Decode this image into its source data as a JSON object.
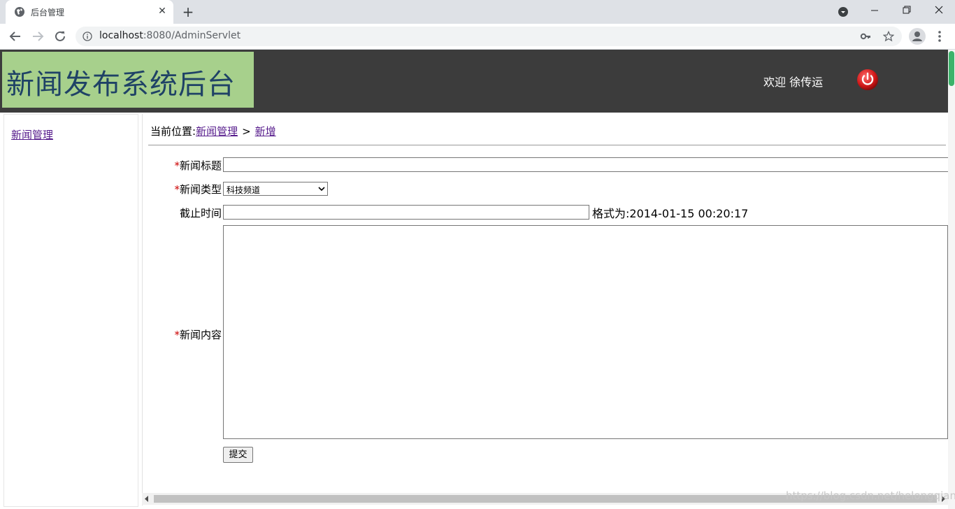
{
  "browser": {
    "tab_title": "后台管理",
    "url_host": "localhost",
    "url_path": ":8080/AdminServlet"
  },
  "header": {
    "logo_text": "新闻发布系统后台",
    "welcome_text": "欢迎 徐传运",
    "power_icon": "power-icon"
  },
  "sidebar": {
    "items": [
      {
        "label": "新闻管理"
      }
    ]
  },
  "breadcrumb": {
    "prefix": "当前位置:",
    "section": "新闻管理",
    "separator": ">",
    "current": "新增"
  },
  "form": {
    "required_mark": "*",
    "title_label": "新闻标题",
    "title_value": "",
    "type_label": "新闻类型",
    "type_selected": "科技频道",
    "deadline_label": "截止时间",
    "deadline_value": "",
    "deadline_hint": "格式为:2014-01-15 00:20:17",
    "content_label": "新闻内容",
    "content_value": "",
    "submit_label": "提交"
  },
  "watermark": "https://blog.csdn.net/helongqiang",
  "colors": {
    "header_bg": "#3c3c3c",
    "logo_bg": "#a7d08c",
    "logo_text": "#1f4266",
    "link": "#551a8b",
    "required": "#cc0000"
  }
}
